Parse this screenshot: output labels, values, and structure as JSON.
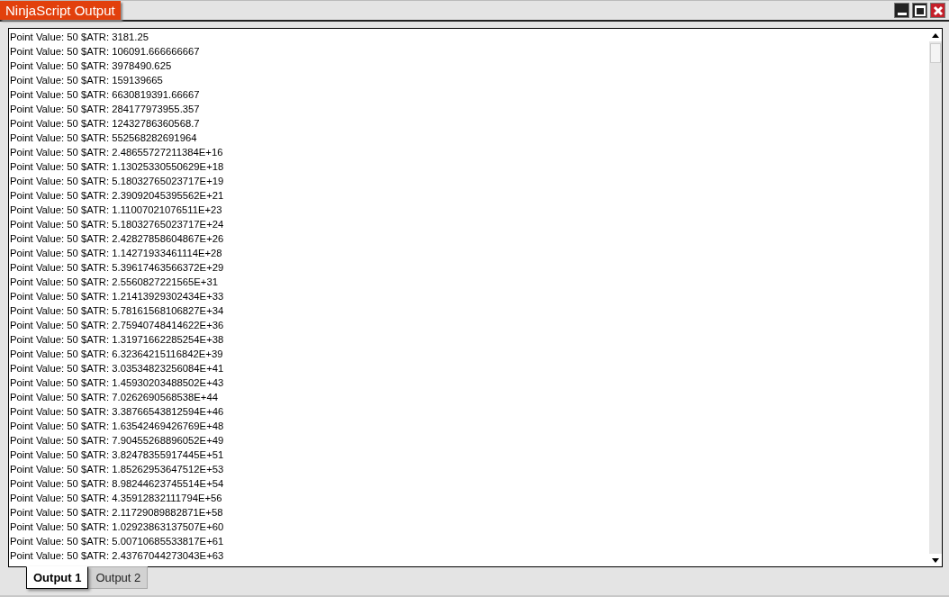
{
  "window": {
    "title": "NinjaScript Output"
  },
  "output_lines": [
    "Point Value: 50 $ATR: 3181.25",
    "Point Value: 50 $ATR: 106091.666666667",
    "Point Value: 50 $ATR: 3978490.625",
    "Point Value: 50 $ATR: 159139665",
    "Point Value: 50 $ATR: 6630819391.66667",
    "Point Value: 50 $ATR: 284177973955.357",
    "Point Value: 50 $ATR: 12432786360568.7",
    "Point Value: 50 $ATR: 552568282691964",
    "Point Value: 50 $ATR: 2.48655727211384E+16",
    "Point Value: 50 $ATR: 1.13025330550629E+18",
    "Point Value: 50 $ATR: 5.18032765023717E+19",
    "Point Value: 50 $ATR: 2.39092045395562E+21",
    "Point Value: 50 $ATR: 1.11007021076511E+23",
    "Point Value: 50 $ATR: 5.18032765023717E+24",
    "Point Value: 50 $ATR: 2.42827858604867E+26",
    "Point Value: 50 $ATR: 1.14271933461114E+28",
    "Point Value: 50 $ATR: 5.39617463566372E+29",
    "Point Value: 50 $ATR: 2.5560827221565E+31",
    "Point Value: 50 $ATR: 1.21413929302434E+33",
    "Point Value: 50 $ATR: 5.78161568106827E+34",
    "Point Value: 50 $ATR: 2.75940748414622E+36",
    "Point Value: 50 $ATR: 1.31971662285254E+38",
    "Point Value: 50 $ATR: 6.32364215116842E+39",
    "Point Value: 50 $ATR: 3.03534823256084E+41",
    "Point Value: 50 $ATR: 1.45930203488502E+43",
    "Point Value: 50 $ATR: 7.0262690568538E+44",
    "Point Value: 50 $ATR: 3.38766543812594E+46",
    "Point Value: 50 $ATR: 1.63542469426769E+48",
    "Point Value: 50 $ATR: 7.90455268896052E+49",
    "Point Value: 50 $ATR: 3.82478355917445E+51",
    "Point Value: 50 $ATR: 1.85262953647512E+53",
    "Point Value: 50 $ATR: 8.98244623745514E+54",
    "Point Value: 50 $ATR: 4.35912832111794E+56",
    "Point Value: 50 $ATR: 2.11729089882871E+58",
    "Point Value: 50 $ATR: 1.02923863137507E+60",
    "Point Value: 50 $ATR: 5.00710685533817E+61",
    "Point Value: 50 $ATR: 2.43767044273043E+63"
  ],
  "tabs": [
    {
      "label": "Output 1",
      "selected": true
    },
    {
      "label": "Output 2",
      "selected": false
    }
  ]
}
